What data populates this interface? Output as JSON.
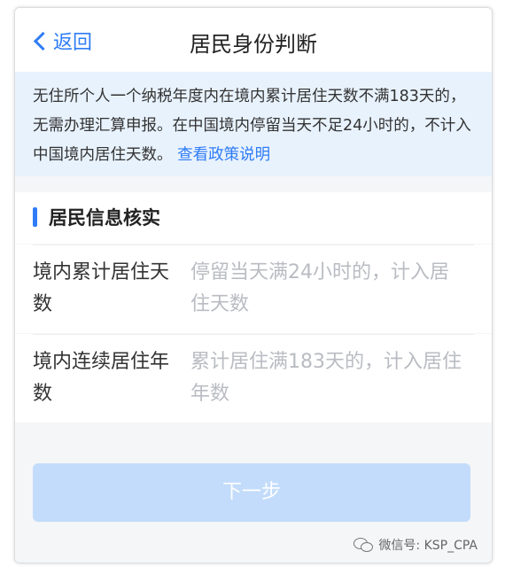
{
  "nav": {
    "back_label": "返回",
    "title": "居民身份判断"
  },
  "notice": {
    "text": "无住所个人一个纳税年度内在境内累计居住天数不满183天的，无需办理汇算申报。在中国境内停留当天不足24小时的，不计入中国境内居住天数。",
    "link_label": "查看政策说明"
  },
  "section": {
    "title": "居民信息核实"
  },
  "form": {
    "rows": [
      {
        "label": "境内累计居住天数",
        "placeholder": "停留当天满24小时的，计入居住天数"
      },
      {
        "label": "境内连续居住年数",
        "placeholder": "累计居住满183天的，计入居住年数"
      }
    ]
  },
  "actions": {
    "next_label": "下一步"
  },
  "watermark": {
    "icon": "wechat-icon",
    "text": "微信号: KSP_CPA"
  },
  "colors": {
    "accent": "#2f7cf6",
    "notice_bg": "#e8f2fd",
    "button_disabled": "#c3dcfb",
    "placeholder": "#b9bcc2"
  }
}
